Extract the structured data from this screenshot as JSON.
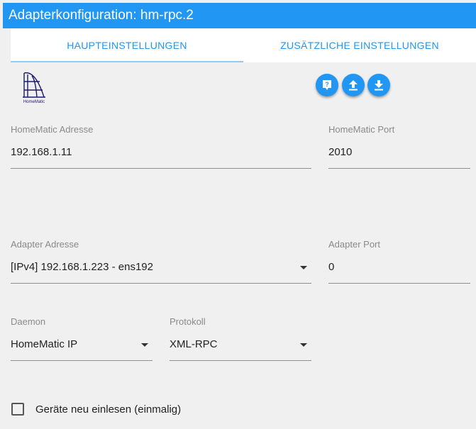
{
  "window": {
    "title": "Adapterkonfiguration: hm-rpc.2"
  },
  "tabs": [
    {
      "label": "HAUPTEINSTELLUNGEN",
      "active": true
    },
    {
      "label": "ZUSÄTZLICHE EINSTELLUNGEN",
      "active": false
    }
  ],
  "logo": {
    "text": "HomeMatic",
    "icon": "homematic-logo"
  },
  "toolbar": {
    "help_icon": "help-icon",
    "upload_icon": "upload-icon",
    "download_icon": "download-icon",
    "accent": "#2196f3"
  },
  "fields": {
    "homematic_address": {
      "label": "HomeMatic Adresse",
      "value": "192.168.1.11"
    },
    "homematic_port": {
      "label": "HomeMatic Port",
      "value": "2010"
    },
    "adapter_address": {
      "label": "Adapter Adresse",
      "value": "[IPv4] 192.168.1.223 - ens192"
    },
    "adapter_port": {
      "label": "Adapter Port",
      "value": "0"
    },
    "daemon": {
      "label": "Daemon",
      "value": "HomeMatic IP"
    },
    "protocol": {
      "label": "Protokoll",
      "value": "XML-RPC"
    }
  },
  "checkbox": {
    "label": "Geräte neu einlesen (einmalig)",
    "checked": false
  }
}
